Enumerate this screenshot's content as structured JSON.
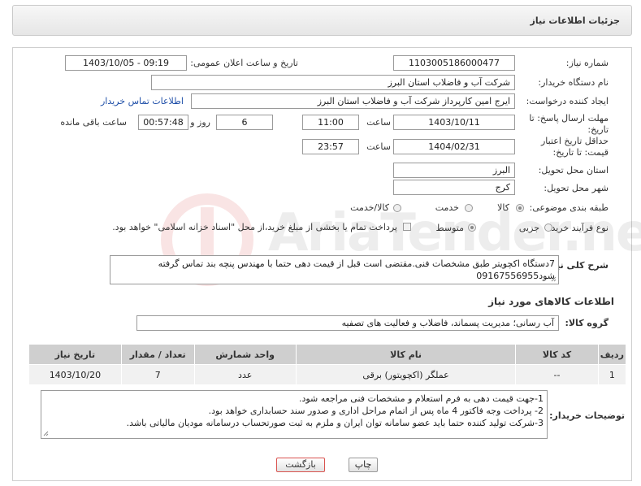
{
  "header": {
    "title": "جزئیات اطلاعات نیاز"
  },
  "form": {
    "need_number_label": "شماره نیاز:",
    "need_number": "1103005186000477",
    "announce_label": "تاریخ و ساعت اعلان عمومی:",
    "announce_value": "1403/10/05 - 09:19",
    "buyer_label": "نام دستگاه خریدار:",
    "buyer_value": "شرکت آب و فاضلاب استان البرز",
    "creator_label": "ایجاد کننده درخواست:",
    "creator_value": "ایرج امین کارپرداز شرکت آب و فاضلاب استان البرز",
    "contact_link": "اطلاعات تماس خریدار",
    "deadline_label": "مهلت ارسال پاسخ: تا تاریخ:",
    "deadline_date": "1403/10/11",
    "time_label": "ساعت",
    "deadline_time": "11:00",
    "days_value": "6",
    "days_label": "روز و",
    "remaining_value": "00:57:48",
    "remaining_label": "ساعت باقی مانده",
    "validity_label": "حداقل تاریخ اعتبار قیمت: تا تاریخ:",
    "validity_date": "1404/02/31",
    "validity_time_label": "ساعت",
    "validity_time": "23:57",
    "province_label": "استان محل تحویل:",
    "province_value": "البرز",
    "city_label": "شهر محل تحویل:",
    "city_value": "کرج",
    "category_label": "طبقه بندی موضوعی:",
    "category_options": [
      "کالا",
      "خدمت",
      "کالا/خدمت"
    ],
    "category_selected": "کالا",
    "process_label": "نوع فرآیند خرید :",
    "process_options": [
      "جزیی",
      "متوسط"
    ],
    "process_selected": "متوسط",
    "payment_note": "پرداخت تمام یا بخشی از مبلغ خرید،از محل \"اسناد خزانه اسلامی\" خواهد بود."
  },
  "summary": {
    "label": "شرح کلی نیاز:",
    "text": "7دستگاه اکچویتر طبق مشخصات فنی.مقتضی است قبل از قیمت دهی حتما با مهندس پنچه بند تماس گرفته شود09167556955"
  },
  "goods": {
    "section_title": "اطلاعات کالاهای مورد نیاز",
    "group_label": "گروه کالا:",
    "group_value": "آب رسانی؛ مدیریت پسماند، فاضلاب و فعالیت های تصفیه",
    "columns": [
      "ردیف",
      "کد کالا",
      "نام کالا",
      "واحد شمارش",
      "تعداد / مقدار",
      "تاریخ نیاز"
    ],
    "rows": [
      {
        "row": "1",
        "code": "--",
        "name": "عملگر (اکچویتور) برقی",
        "unit": "عدد",
        "qty": "7",
        "date": "1403/10/20"
      }
    ]
  },
  "buyer_notes": {
    "label": "توضیحات خریدار:",
    "lines": [
      "1-جهت قیمت دهی به فرم استعلام و مشخصات فنی مراجعه شود.",
      "2- پرداخت وجه فاکتور 4 ماه پس از اتمام مراحل اداری و صدور سند حسابداری خواهد بود.",
      "3-شرکت تولید کننده حتما باید عضو سامانه توان ایران و ملزم به ثبت صورتحساب درسامانه مودیان مالیاتی باشد."
    ]
  },
  "buttons": {
    "print": "چاپ",
    "back": "بازگشت"
  },
  "watermark": {
    "text": "AriaTender.neT"
  },
  "colors": {
    "link": "#1f4fa8",
    "table_header": "#cfcfcf",
    "back_button_border": "#d9534f"
  }
}
